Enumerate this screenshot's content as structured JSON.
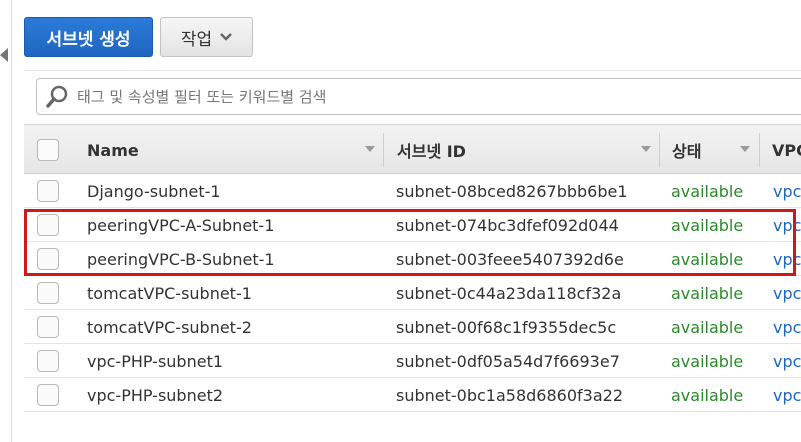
{
  "toolbar": {
    "create_label": "서브넷 생성",
    "actions_label": "작업"
  },
  "search": {
    "placeholder": "태그 및 속성별 필터 또는 키워드별 검색"
  },
  "table": {
    "columns": [
      "Name",
      "서브넷 ID",
      "상태",
      "VPC"
    ],
    "rows": [
      {
        "name": "Django-subnet-1",
        "subnet_id": "subnet-08bced8267bbb6be1",
        "status": "available",
        "vpc": "vpc"
      },
      {
        "name": "peeringVPC-A-Subnet-1",
        "subnet_id": "subnet-074bc3dfef092d044",
        "status": "available",
        "vpc": "vpc"
      },
      {
        "name": "peeringVPC-B-Subnet-1",
        "subnet_id": "subnet-003feee5407392d6e",
        "status": "available",
        "vpc": "vpc"
      },
      {
        "name": "tomcatVPC-subnet-1",
        "subnet_id": "subnet-0c44a23da118cf32a",
        "status": "available",
        "vpc": "vpc"
      },
      {
        "name": "tomcatVPC-subnet-2",
        "subnet_id": "subnet-00f68c1f9355dec5c",
        "status": "available",
        "vpc": "vpc"
      },
      {
        "name": "vpc-PHP-subnet1",
        "subnet_id": "subnet-0df05a54d7f6693e7",
        "status": "available",
        "vpc": "vpc"
      },
      {
        "name": "vpc-PHP-subnet2",
        "subnet_id": "subnet-0bc1a58d6860f3a22",
        "status": "available",
        "vpc": "vpc"
      }
    ]
  },
  "colors": {
    "primary": "#1f66c1",
    "status_available": "#2a8a2a",
    "highlight": "#cc1a1a"
  },
  "icons": {
    "collapse": "chevron-left-icon",
    "actions_caret": "chevron-down-icon",
    "search": "search-icon",
    "sort": "sort-caret-icon"
  }
}
